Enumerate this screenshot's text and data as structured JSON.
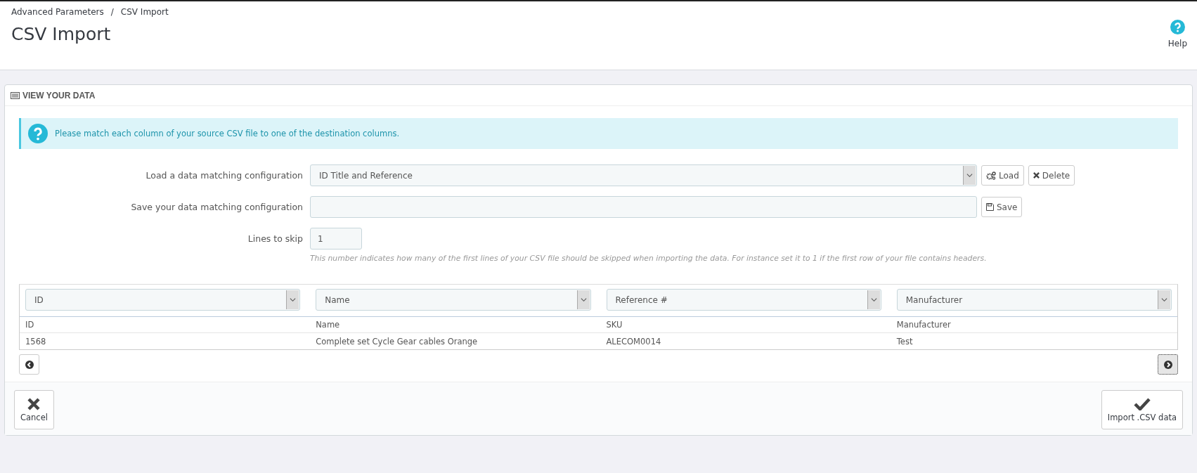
{
  "breadcrumb": [
    "Advanced Parameters",
    "CSV Import"
  ],
  "breadcrumb_separator": "/",
  "page_title": "CSV Import",
  "help": {
    "label": "Help"
  },
  "panel": {
    "title": "VIEW YOUR DATA",
    "alert": "Please match each column of your source CSV file to one of the destination columns.",
    "load_config": {
      "label": "Load a data matching configuration",
      "value": "ID Title and Reference",
      "buttons": [
        {
          "kind": "load",
          "label": "Load"
        },
        {
          "kind": "delete",
          "label": "Delete"
        }
      ]
    },
    "save_config": {
      "label": "Save your data matching configuration",
      "button": "Save"
    },
    "lines_to_skip": {
      "label": "Lines to skip",
      "value": "1",
      "hint": "This number indicates how many of the first lines of your CSV file should be skipped when importing the data. For instance set it to 1 if the first row of your file contains headers."
    },
    "column_selects": [
      "ID",
      "Name",
      "Reference #",
      "Manufacturer"
    ],
    "table": {
      "columns": [
        "ID",
        "Name",
        "SKU",
        "Manufacturer"
      ],
      "rows": [
        [
          "1568",
          "Complete set Cycle Gear cables Orange",
          "ALECOM0014",
          "Test"
        ]
      ]
    },
    "footer": {
      "cancel": "Cancel",
      "import": "Import .CSV data"
    }
  }
}
